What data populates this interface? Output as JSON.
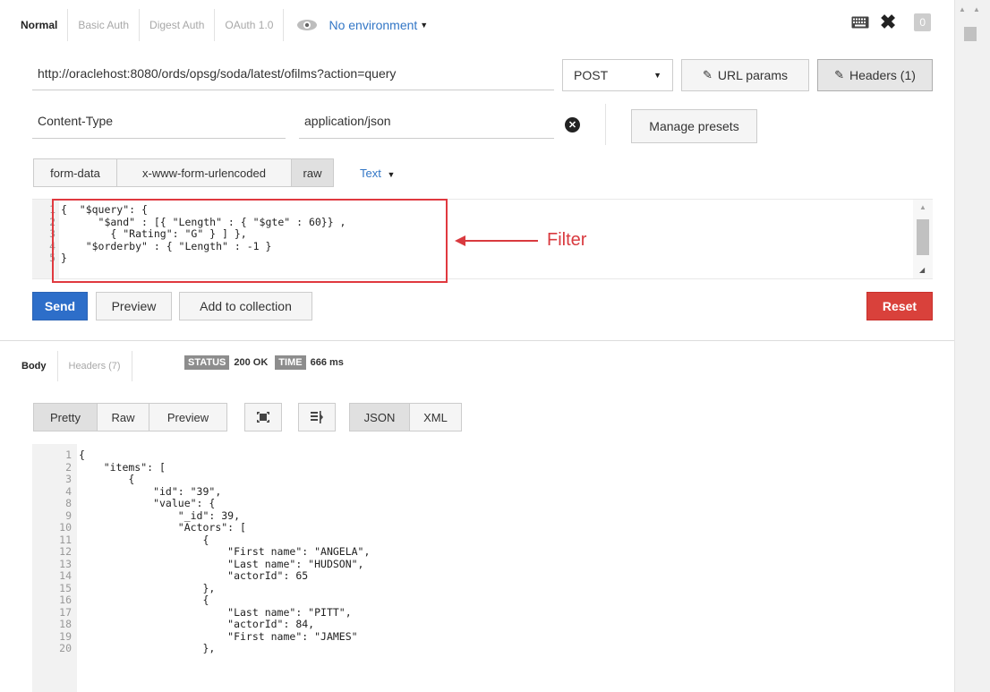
{
  "auth_tabs": [
    "Normal",
    "Basic Auth",
    "Digest Auth",
    "OAuth 1.0"
  ],
  "environment": "No environment",
  "top_badge": "0",
  "request": {
    "url": "http://oraclehost:8080/ords/opsg/soda/latest/ofilms?action=query",
    "method": "POST",
    "url_params_label": "URL params",
    "headers_label": "Headers (1)",
    "header_key": "Content-Type",
    "header_value": "application/json",
    "manage_presets_label": "Manage presets",
    "body_modes": [
      "form-data",
      "x-www-form-urlencoded",
      "raw"
    ],
    "text_type": "Text",
    "body_line_numbers": "1\n2\n3\n4\n5",
    "body_code": "{  \"$query\": {\n      \"$and\" : [{ \"Length\" : { \"$gte\" : 60}} ,\n        { \"Rating\": \"G\" } ] },\n    \"$orderby\" : { \"Length\" : -1 }\n}"
  },
  "annotation": {
    "label": "Filter",
    "color": "#d93a3f"
  },
  "actions": {
    "send_label": "Send",
    "preview_label": "Preview",
    "add_collection_label": "Add to collection",
    "reset_label": "Reset"
  },
  "response": {
    "tabs": [
      "Body",
      "Headers (7)"
    ],
    "status_tag": "STATUS",
    "status_value": "200 OK",
    "time_tag": "TIME",
    "time_value": "666 ms",
    "view_modes": [
      "Pretty",
      "Raw",
      "Preview"
    ],
    "formats": [
      "JSON",
      "XML"
    ],
    "icons": [
      "fullscreen-icon",
      "wrap-lines-icon"
    ],
    "line_numbers": "1\n2\n3\n4\n8\n9\n10\n11\n12\n13\n14\n15\n16\n17\n18\n19\n20",
    "code_lines": [
      "{",
      "    \"items\": [",
      "        {",
      "            \"id\": \"39\",",
      "            \"value\": {",
      "                \"_id\": 39,",
      "                \"Actors\": [",
      "                    {",
      "                        \"First name\": \"ANGELA\",",
      "                        \"Last name\": \"HUDSON\",",
      "                        \"actorId\": 65",
      "                    },",
      "                    {",
      "                        \"Last name\": \"PITT\",",
      "                        \"actorId\": 84,",
      "                        \"First name\": \"JAMES\"",
      "                    },"
    ]
  },
  "colors": {
    "accent": "#3276c6",
    "send": "#2d6ec9",
    "reset": "#d9413b",
    "annotation": "#e0393f"
  }
}
